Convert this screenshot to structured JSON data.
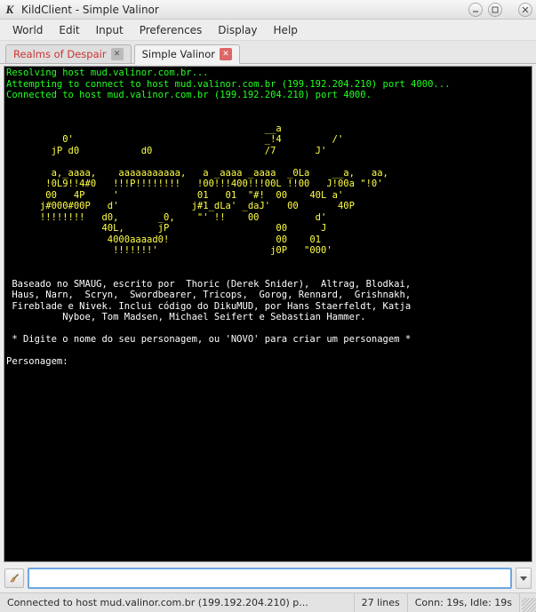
{
  "window": {
    "title": "KildClient - Simple Valinor"
  },
  "menu": {
    "items": [
      "World",
      "Edit",
      "Input",
      "Preferences",
      "Display",
      "Help"
    ]
  },
  "tabs": [
    {
      "label": "Realms of Despair",
      "active": false
    },
    {
      "label": "Simple Valinor",
      "active": true
    }
  ],
  "terminal": {
    "lines": [
      {
        "cls": "green",
        "text": "Resolving host mud.valinor.com.br..."
      },
      {
        "cls": "green",
        "text": "Attempting to connect to host mud.valinor.com.br (199.192.204.210) port 4000..."
      },
      {
        "cls": "green",
        "text": "Connected to host mud.valinor.com.br (199.192.204.210) port 4000."
      },
      {
        "cls": "white",
        "text": ""
      },
      {
        "cls": "white",
        "text": ""
      },
      {
        "cls": "yellow",
        "text": "                                              __a"
      },
      {
        "cls": "yellow",
        "text": "          0'                                  _!4         /'"
      },
      {
        "cls": "yellow",
        "text": "        jP d0           d0                    /7       J'"
      },
      {
        "cls": "yellow",
        "text": ""
      },
      {
        "cls": "yellow",
        "text": "        a,_aaaa,    aaaaaaaaaaa,   a _aaaa _aaaa  _0La    __a,   aa,"
      },
      {
        "cls": "yellow",
        "text": "       !0L9!!4#0   !!!P!!!!!!!!   !00!!!400!!!00L !!00   J!00a \"!0'"
      },
      {
        "cls": "yellow",
        "text": "       00   4P     '              01   01  \"#!  00    40L a'"
      },
      {
        "cls": "yellow",
        "text": "      j#000#00P   d'             j#1_dLa' _daJ'   00       40P"
      },
      {
        "cls": "yellow",
        "text": "      !!!!!!!!   d0,       _0,    \"' !!    00          d'"
      },
      {
        "cls": "yellow",
        "text": "                 40L,      jP                   00      J"
      },
      {
        "cls": "yellow",
        "text": "                  4000aaaad0!                   00    01"
      },
      {
        "cls": "yellow",
        "text": "                   !!!!!!!'                    j0P   \"000'"
      },
      {
        "cls": "white",
        "text": ""
      },
      {
        "cls": "white",
        "text": ""
      },
      {
        "cls": "white",
        "text": " Baseado no SMAUG, escrito por  Thoric (Derek Snider),  Altrag, Blodkai,"
      },
      {
        "cls": "white",
        "text": " Haus, Narn,  Scryn,  Swordbearer, Tricops,  Gorog, Rennard,  Grishnakh,"
      },
      {
        "cls": "white",
        "text": " Fireblade e Nivek. Inclui código do DikuMUD, por Hans Staerfeldt, Katja"
      },
      {
        "cls": "white",
        "text": "          Nyboe, Tom Madsen, Michael Seifert e Sebastian Hammer."
      },
      {
        "cls": "white",
        "text": ""
      },
      {
        "cls": "white",
        "text": " * Digite o nome do seu personagem, ou 'NOVO' para criar um personagem *"
      },
      {
        "cls": "white",
        "text": ""
      },
      {
        "cls": "white",
        "text": "Personagem:"
      }
    ]
  },
  "input": {
    "value": "",
    "placeholder": ""
  },
  "status": {
    "connection": "Connected to host mud.valinor.com.br (199.192.204.210) p...",
    "lines": "27 lines",
    "time": "Conn: 19s, Idle: 19s"
  }
}
